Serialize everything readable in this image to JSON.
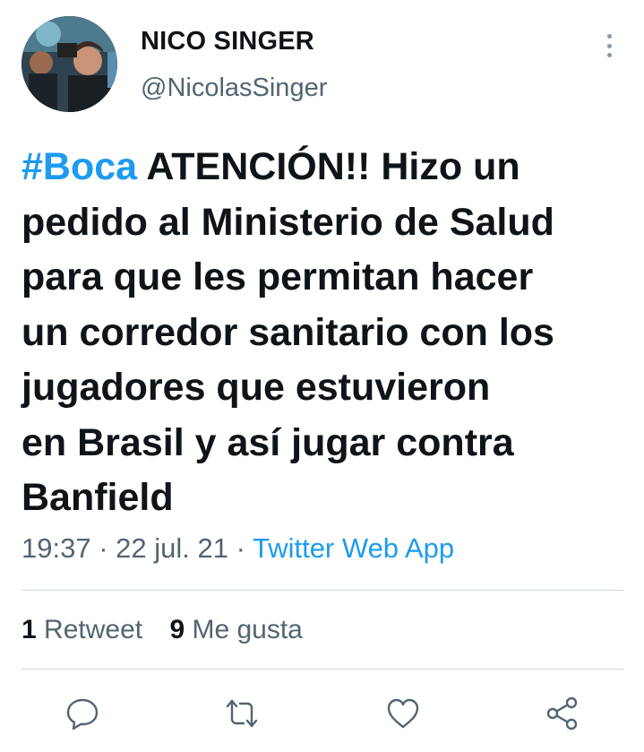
{
  "author": {
    "name": "NICO SINGER",
    "handle": "@NicolasSinger"
  },
  "tweet": {
    "hashtag": "#Boca",
    "lines": [
      " ATENCIÓN!! Hizo un",
      "pedido al Ministerio de Salud",
      "para que les permitan hacer",
      "un corredor sanitario con los",
      "jugadores que estuvieron",
      "en Brasil y así jugar contra",
      "Banfield"
    ]
  },
  "meta": {
    "time": "19:37",
    "sep1": " · ",
    "date": "22 jul. 21",
    "sep2": " · ",
    "source": "Twitter Web App"
  },
  "stats": {
    "retweets_count": "1",
    "retweets_label": "Retweet",
    "likes_count": "9",
    "likes_label": "Me gusta"
  },
  "icons": {
    "more": "more-vertical-icon",
    "reply": "reply-icon",
    "retweet": "retweet-icon",
    "like": "heart-icon",
    "share": "share-icon"
  },
  "colors": {
    "accent": "#1d9bf0",
    "text": "#0f1419",
    "secondary": "#536471",
    "divider": "#cfd9de"
  }
}
